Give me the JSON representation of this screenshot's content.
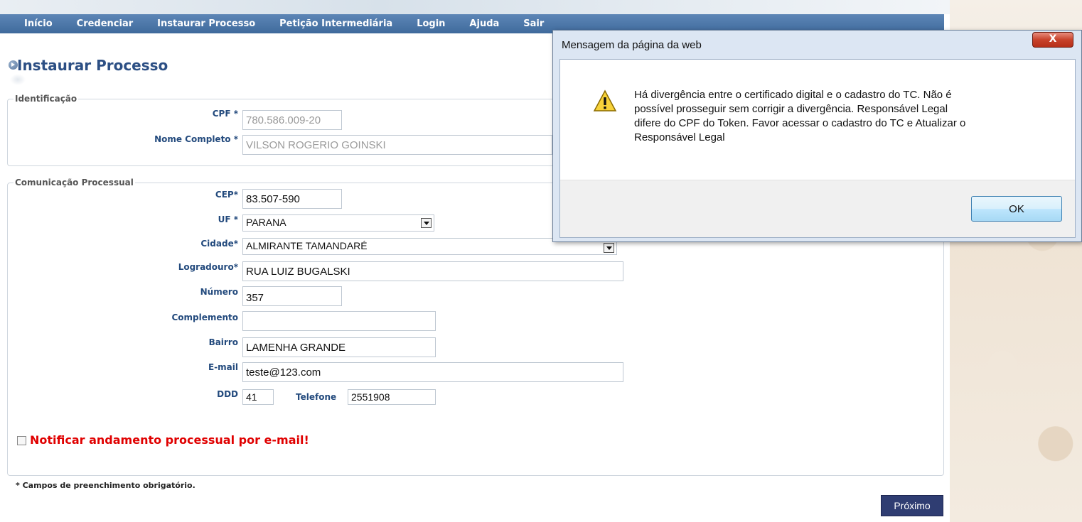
{
  "nav": [
    "Início",
    "Credenciar",
    "Instaurar Processo",
    "Petição Intermediária",
    "Login",
    "Ajuda",
    "Sair"
  ],
  "page_title": "Instaurar Processo",
  "identificacao": {
    "legend": "Identificação",
    "cpf_label": "CPF *",
    "cpf_value": "780.586.009-20",
    "nome_label": "Nome Completo *",
    "nome_value": "VILSON ROGERIO GOINSKI"
  },
  "comunicacao": {
    "legend": "Comunicação Processual",
    "cep_label": "CEP*",
    "cep_value": "83.507-590",
    "uf_label": "UF *",
    "uf_value": "PARANA",
    "cidade_label": "Cidade*",
    "cidade_value": "ALMIRANTE TAMANDARÉ",
    "logradouro_label": "Logradouro*",
    "logradouro_value": "RUA LUIZ BUGALSKI",
    "numero_label": "Número",
    "numero_value": "357",
    "complemento_label": "Complemento",
    "complemento_value": "",
    "bairro_label": "Bairro",
    "bairro_value": "LAMENHA GRANDE",
    "email_label": "E-mail",
    "email_value": "teste@123.com",
    "ddd_label": "DDD",
    "ddd_value": "41",
    "telefone_label": "Telefone",
    "telefone_value": "2551908"
  },
  "notify_label": "Notificar andamento processual por e-mail!",
  "required_note": "* Campos de preenchimento obrigatório.",
  "next_button": "Próximo",
  "dialog": {
    "title": "Mensagem da página da web",
    "close": "X",
    "message": "Há divergência entre o certificado digital e o cadastro do TC. Não é possível prosseguir sem corrigir a divergência. Responsável Legal difere do CPF do Token. Favor acessar o cadastro do TC e Atualizar o Responsável Legal",
    "ok": "OK",
    "icon": "warning-icon"
  }
}
